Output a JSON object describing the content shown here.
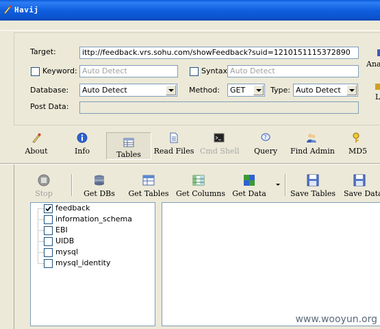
{
  "window": {
    "title": "Havij"
  },
  "target": {
    "label": "Target:",
    "value": "ittp://feedback.vrs.sohu.com/showFeedback?suid=1210151115372890",
    "keyword_label": "Keyword:",
    "keyword_placeholder": "Auto Detect",
    "syntax_label": "Syntax:",
    "syntax_placeholder": "Auto Detect",
    "database_label": "Database:",
    "database_value": "Auto Detect",
    "method_label": "Method:",
    "method_value": "GET",
    "type_label": "Type:",
    "type_value": "Auto Detect",
    "postdata_label": "Post Data:",
    "analyze_label": "Ana",
    "side_label2": "L"
  },
  "tabs": [
    {
      "label": "About",
      "icon": "about-icon"
    },
    {
      "label": "Info",
      "icon": "info-icon"
    },
    {
      "label": "Tables",
      "icon": "tables-icon",
      "selected": true
    },
    {
      "label": "Read Files",
      "icon": "read-files-icon"
    },
    {
      "label": "Cmd Shell",
      "icon": "cmd-shell-icon",
      "disabled": true
    },
    {
      "label": "Query",
      "icon": "query-icon"
    },
    {
      "label": "Find Admin",
      "icon": "find-admin-icon"
    },
    {
      "label": "MD5",
      "icon": "md5-icon"
    }
  ],
  "toolbar": {
    "stop": "Stop",
    "get_dbs": "Get DBs",
    "get_tables": "Get Tables",
    "get_columns": "Get Columns",
    "get_data": "Get Data",
    "save_tables": "Save Tables",
    "save_data": "Save Data"
  },
  "tree": {
    "items": [
      {
        "label": "feedback",
        "checked": true
      },
      {
        "label": "information_schema",
        "checked": false
      },
      {
        "label": "EBI",
        "checked": false
      },
      {
        "label": "UIDB",
        "checked": false
      },
      {
        "label": "mysql",
        "checked": false
      },
      {
        "label": "mysql_identity",
        "checked": false
      }
    ]
  },
  "watermark": "www.wooyun.org",
  "colors": {
    "titlebar": "#0a5bd8",
    "face": "#ece9d8",
    "border": "#7f9db9"
  }
}
